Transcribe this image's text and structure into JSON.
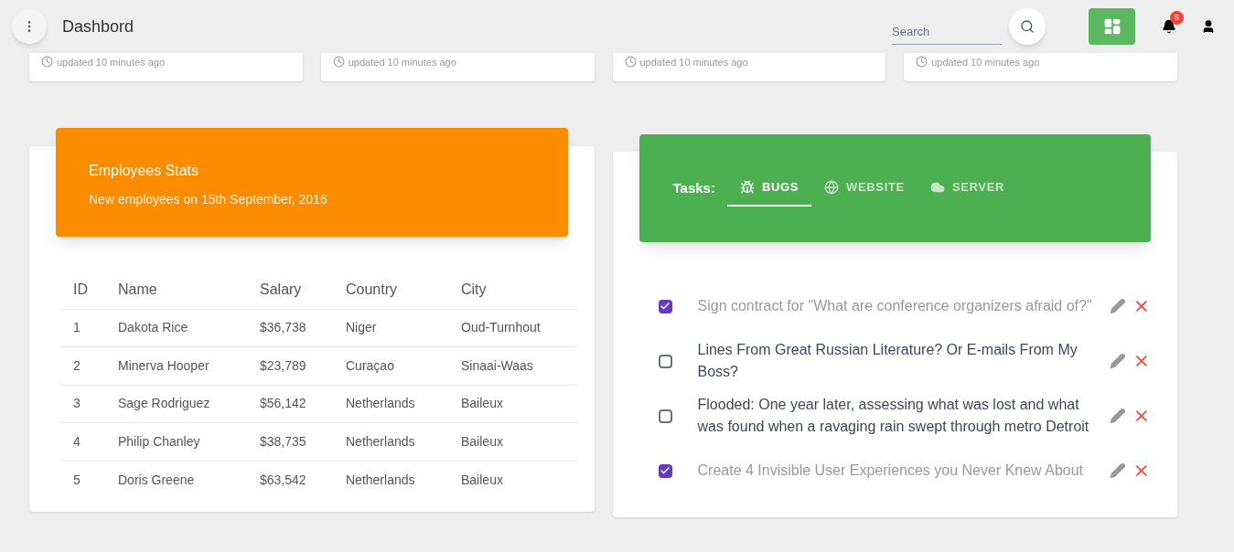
{
  "header": {
    "title": "Dashbord",
    "search": {
      "placeholder": "Search"
    },
    "notifications": "5"
  },
  "stat_cards": [
    {
      "footer": "updated 10 minutes ago"
    },
    {
      "footer": "updated 10 minutes ago"
    },
    {
      "footer": "updated 10 minutes ago"
    },
    {
      "footer": "updated 10 minutes ago"
    }
  ],
  "employees": {
    "title": "Employees Stats",
    "subtitle": "New employees on 15th September, 2016",
    "columns": [
      "ID",
      "Name",
      "Salary",
      "Country",
      "City"
    ],
    "rows": [
      [
        "1",
        "Dakota Rice",
        "$36,738",
        "Niger",
        "Oud-Turnhout"
      ],
      [
        "2",
        "Minerva Hooper",
        "$23,789",
        "Curaçao",
        "Sinaai-Waas"
      ],
      [
        "3",
        "Sage Rodriguez",
        "$56,142",
        "Netherlands",
        "Baileux"
      ],
      [
        "4",
        "Philip Chanley",
        "$38,735",
        "Netherlands",
        "Baileux"
      ],
      [
        "5",
        "Doris Greene",
        "$63,542",
        "Netherlands",
        "Baileux"
      ]
    ]
  },
  "tasks": {
    "label": "Tasks:",
    "tabs": [
      {
        "label": "BUGS",
        "kind": "bug",
        "selected": true
      },
      {
        "label": "WEBSITE",
        "kind": "globe",
        "selected": false
      },
      {
        "label": "SERVER",
        "kind": "cloud",
        "selected": false
      }
    ],
    "items": [
      {
        "text": "Sign contract for \"What are conference organizers afraid of?\"",
        "checked": true
      },
      {
        "text": "Lines From Great Russian Literature? Or E-mails From My Boss?",
        "checked": false
      },
      {
        "text": "Flooded: One year later, assessing what was lost and what was found when a ravaging rain swept through metro Detroit",
        "checked": false
      },
      {
        "text": "Create 4 Invisible User Experiences you Never Knew About",
        "checked": true
      }
    ]
  }
}
